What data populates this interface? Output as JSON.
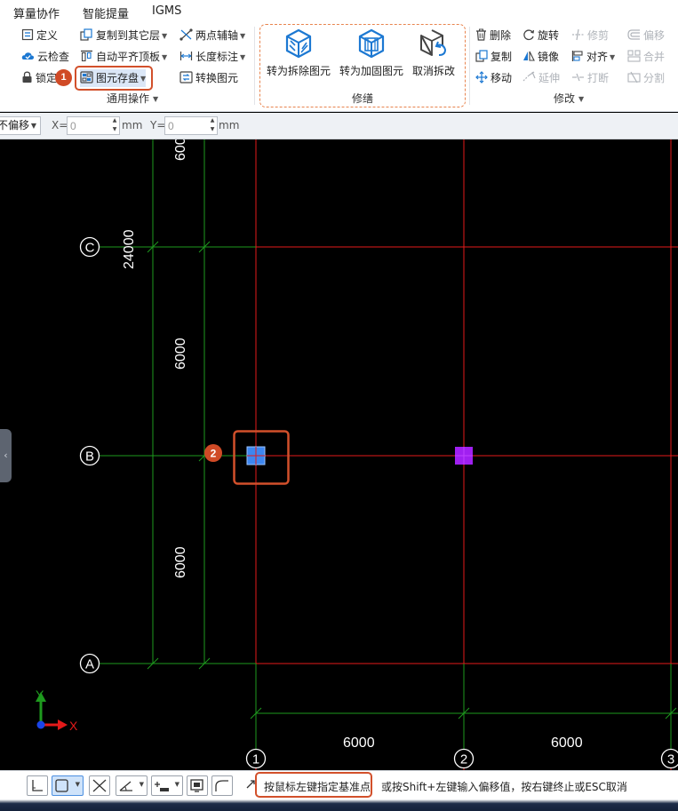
{
  "menu": [
    "算量协作",
    "智能提量",
    "IGMS"
  ],
  "ribbon": {
    "general_ops": {
      "define": "定义",
      "cloud_check": "云检查",
      "lock": "锁定",
      "copy_to_layer": "复制到其它层",
      "auto_align_top": "自动平齐顶板",
      "element_store": "图元存盘",
      "two_point_axis": "两点辅轴",
      "length_dim": "长度标注",
      "convert_element": "转换图元",
      "group_label": "通用操作"
    },
    "repair": {
      "to_removal": "转为拆除图元",
      "to_reinforce": "转为加固图元",
      "cancel_removal": "取消拆改",
      "group_label": "修缮"
    },
    "modify": {
      "delete": "删除",
      "copy": "复制",
      "move": "移动",
      "rotate": "旋转",
      "mirror": "镜像",
      "extend": "延伸",
      "trim": "修剪",
      "align": "对齐",
      "break": "打断",
      "offset": "偏移",
      "merge": "合并",
      "split": "分割",
      "group_label": "修改"
    }
  },
  "markers": {
    "m1": "1",
    "m2": "2"
  },
  "options": {
    "offset_mode": "不偏移",
    "x_label": "X=",
    "x_value": "0",
    "y_label": "Y=",
    "y_value": "0",
    "unit": "mm"
  },
  "grid": {
    "axis_labels": {
      "c": "C",
      "b": "B",
      "a": "A",
      "n1": "1",
      "n2": "2",
      "n3": "3"
    },
    "dims": {
      "top_partial": "600",
      "left_total": "24000",
      "cb": "6000",
      "ba": "6000",
      "bottom_12": "6000",
      "bottom_23": "6000"
    }
  },
  "coords": {
    "x": "X",
    "y": "Y"
  },
  "status": {
    "prompt": "按鼠标左键指定基准点",
    "hint": "或按Shift+左键输入偏移值，按右键终止或ESC取消"
  },
  "colors": {
    "grid_axis": "#e31a1a",
    "grid_dim": "#1e9a1e",
    "highlight": "#d2502b",
    "column_blue": "#3d86f0",
    "column_purple": "#a020f0",
    "ribbon_icon": "#1c78d2"
  }
}
